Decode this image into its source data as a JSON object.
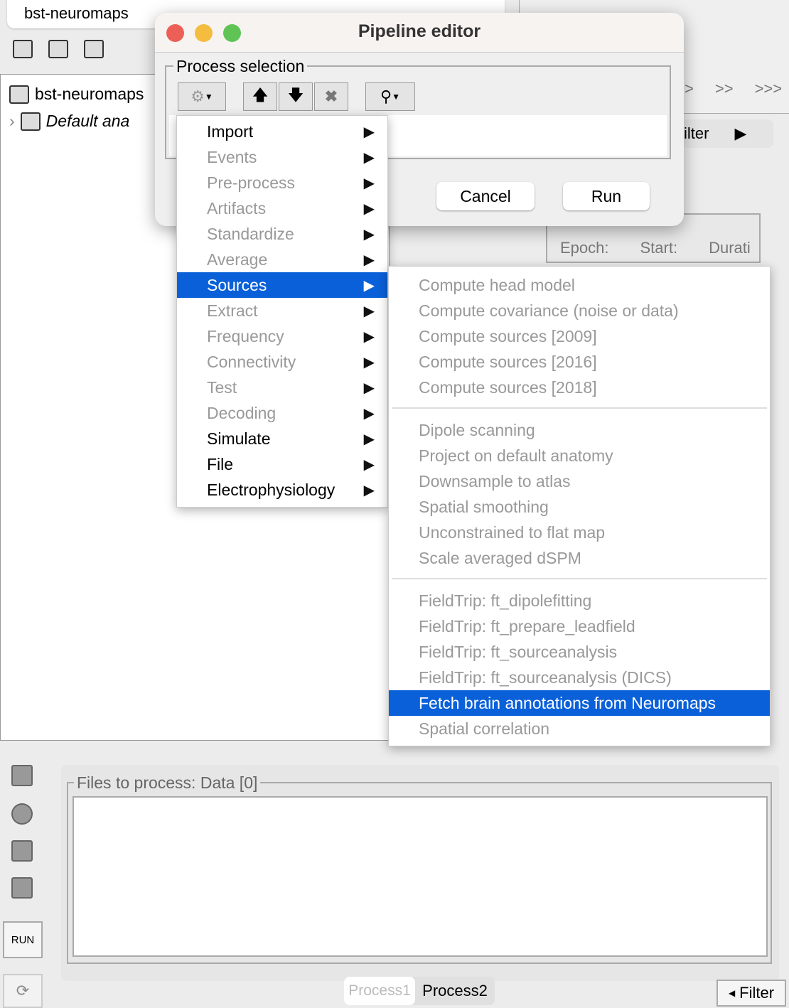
{
  "explorer": {
    "protocol_tab": "bst-neuromaps",
    "tree_root": "bst-neuromaps",
    "tree_child": "Default ana"
  },
  "background": {
    "nav": [
      ">",
      ">>",
      ">>>"
    ],
    "filter_tab": "ilter",
    "epoch_label": "Epoch:",
    "start_label": "Start:",
    "duration_label": "Durati"
  },
  "dialog": {
    "title": "Pipeline editor",
    "group_label": "Process selection",
    "cancel": "Cancel",
    "run": "Run"
  },
  "menu": {
    "items": [
      {
        "label": "Import",
        "enabled": true
      },
      {
        "label": "Events",
        "enabled": false
      },
      {
        "label": "Pre-process",
        "enabled": false
      },
      {
        "label": "Artifacts",
        "enabled": false
      },
      {
        "label": "Standardize",
        "enabled": false
      },
      {
        "label": "Average",
        "enabled": false
      },
      {
        "label": "Sources",
        "enabled": true,
        "selected": true
      },
      {
        "label": "Extract",
        "enabled": false
      },
      {
        "label": "Frequency",
        "enabled": false
      },
      {
        "label": "Connectivity",
        "enabled": false
      },
      {
        "label": "Test",
        "enabled": false
      },
      {
        "label": "Decoding",
        "enabled": false
      },
      {
        "label": "Simulate",
        "enabled": true
      },
      {
        "label": "File",
        "enabled": true
      },
      {
        "label": "Electrophysiology",
        "enabled": true
      }
    ]
  },
  "submenu": {
    "groups": [
      [
        "Compute head model",
        "Compute covariance (noise or data)",
        "Compute sources [2009]",
        "Compute sources [2016]",
        "Compute sources [2018]"
      ],
      [
        "Dipole scanning",
        "Project on default anatomy",
        "Downsample to atlas",
        "Spatial smoothing",
        "Unconstrained to flat map",
        "Scale averaged dSPM"
      ],
      [
        "FieldTrip: ft_dipolefitting",
        "FieldTrip: ft_prepare_leadfield",
        "FieldTrip: ft_sourceanalysis",
        "FieldTrip: ft_sourceanalysis (DICS)",
        "Fetch brain annotations from Neuromaps",
        "Spatial correlation"
      ]
    ],
    "selected": "Fetch brain annotations from Neuromaps"
  },
  "process": {
    "files_label": "Files to process: Data [0]",
    "run_button": "RUN",
    "tabs": [
      "Process1",
      "Process2"
    ],
    "filter": "Filter"
  },
  "colors": {
    "highlight": "#0a60d8",
    "close": "#ec5f57",
    "minimize": "#f4bd3f",
    "zoom": "#5fc454"
  }
}
